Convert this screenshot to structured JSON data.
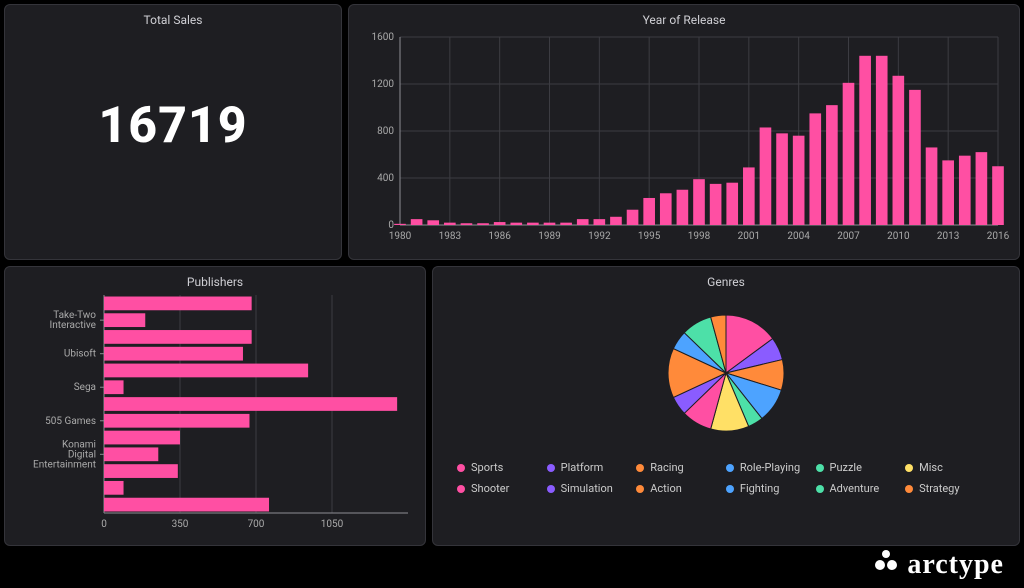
{
  "brand": "arctype",
  "cards": {
    "total_sales": {
      "title": "Total Sales",
      "value": "16719"
    },
    "year": {
      "title": "Year of Release"
    },
    "publishers": {
      "title": "Publishers"
    },
    "genres": {
      "title": "Genres"
    }
  },
  "chart_data": [
    {
      "id": "year_of_release",
      "type": "bar",
      "title": "Year of Release",
      "xlabel": "",
      "ylabel": "",
      "ylim": [
        0,
        1600
      ],
      "yticks": [
        0,
        400,
        800,
        1200,
        1600
      ],
      "xticks": [
        1980,
        1983,
        1986,
        1989,
        1992,
        1995,
        1998,
        2001,
        2004,
        2007,
        2010,
        2013,
        2016
      ],
      "x": [
        1980,
        1981,
        1982,
        1983,
        1984,
        1985,
        1986,
        1987,
        1988,
        1989,
        1990,
        1991,
        1992,
        1993,
        1994,
        1995,
        1996,
        1997,
        1998,
        1999,
        2000,
        2001,
        2002,
        2003,
        2004,
        2005,
        2006,
        2007,
        2008,
        2009,
        2010,
        2011,
        2012,
        2013,
        2014,
        2015,
        2016
      ],
      "values": [
        10,
        50,
        40,
        20,
        15,
        15,
        25,
        20,
        20,
        20,
        20,
        50,
        50,
        70,
        130,
        230,
        270,
        300,
        390,
        350,
        360,
        490,
        830,
        780,
        760,
        950,
        1020,
        1210,
        1440,
        1440,
        1270,
        1150,
        660,
        550,
        590,
        620,
        500
      ]
    },
    {
      "id": "publishers",
      "type": "bar",
      "orientation": "horizontal",
      "title": "Publishers",
      "xlim": [
        0,
        1400
      ],
      "xticks": [
        0,
        350,
        700,
        1050
      ],
      "ytick_label_indices": [
        1,
        3,
        5,
        7,
        9
      ],
      "categories": [
        "(row1)",
        "Take-Two Interactive",
        "(row3)",
        "Ubisoft",
        "(row5)",
        "Sega",
        "(row7)",
        "505 Games",
        "(row9)",
        "Konami Digital Entertainment"
      ],
      "values": [
        680,
        190,
        680,
        640,
        940,
        90,
        1350,
        670,
        350,
        250,
        340,
        90,
        760
      ]
    },
    {
      "id": "genres",
      "type": "pie",
      "title": "Genres",
      "series": [
        {
          "name": "Sports",
          "value": 14,
          "color": "#ff4fa3"
        },
        {
          "name": "Platform",
          "value": 6,
          "color": "#8a5cff"
        },
        {
          "name": "Racing",
          "value": 8,
          "color": "#ff8a3a"
        },
        {
          "name": "Role-Playing",
          "value": 9,
          "color": "#4da3ff"
        },
        {
          "name": "Puzzle",
          "value": 4,
          "color": "#4de0a8"
        },
        {
          "name": "Misc",
          "value": 10,
          "color": "#ffe066"
        },
        {
          "name": "Shooter",
          "value": 8,
          "color": "#ff4fa3"
        },
        {
          "name": "Simulation",
          "value": 5,
          "color": "#8a5cff"
        },
        {
          "name": "Action",
          "value": 13,
          "color": "#ff8a3a"
        },
        {
          "name": "Fighting",
          "value": 5,
          "color": "#4da3ff"
        },
        {
          "name": "Adventure",
          "value": 8,
          "color": "#4de0a8"
        },
        {
          "name": "Strategy",
          "value": 4,
          "color": "#ff8a3a"
        }
      ]
    }
  ]
}
